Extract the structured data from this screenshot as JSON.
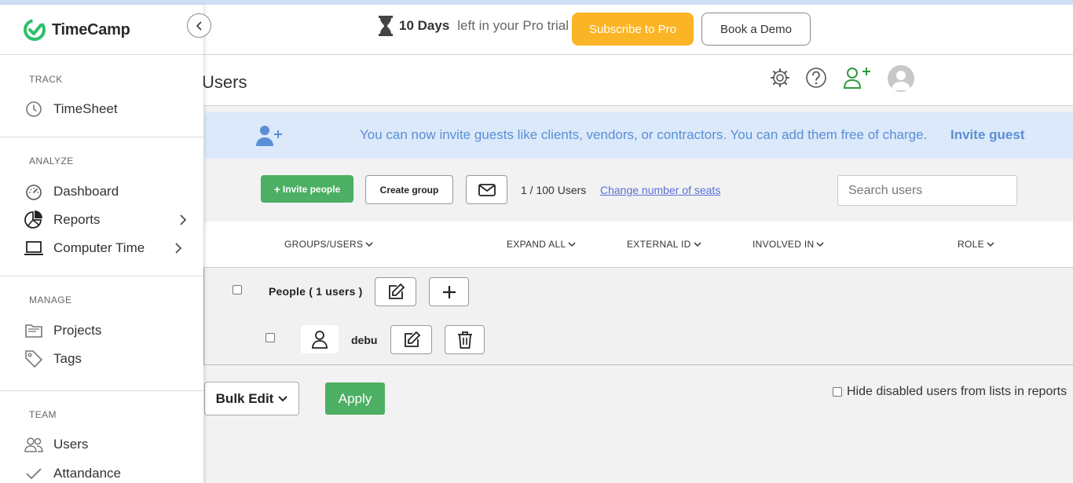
{
  "app": {
    "name": "TimeCamp"
  },
  "sidebar": {
    "sections": [
      {
        "label": "TRACK",
        "items": [
          {
            "label": "TimeSheet"
          }
        ]
      },
      {
        "label": "ANALYZE",
        "items": [
          {
            "label": "Dashboard"
          },
          {
            "label": "Reports"
          },
          {
            "label": "Computer Time"
          }
        ]
      },
      {
        "label": "MANAGE",
        "items": [
          {
            "label": "Projects"
          },
          {
            "label": "Tags"
          }
        ]
      },
      {
        "label": "TEAM",
        "items": [
          {
            "label": "Users"
          },
          {
            "label": "Attandance"
          }
        ]
      }
    ]
  },
  "header": {
    "trial_days": "10 Days",
    "trial_rest": "left in your Pro trial",
    "subscribe_label": "Subscribe to Pro",
    "demo_label": "Book a Demo"
  },
  "page": {
    "title": "Users"
  },
  "banner": {
    "text": "You can now invite guests like clients, vendors, or contractors. You can add them free of charge.",
    "link": "Invite guest"
  },
  "toolbar": {
    "invite_label": "Invite people",
    "create_group_label": "Create group",
    "users_count": "1 / 100 Users",
    "seats_link": "Change number of seats",
    "search_placeholder": "Search users"
  },
  "table": {
    "columns": [
      "GROUPS/USERS",
      "EXPAND ALL",
      "EXTERNAL ID",
      "INVOLVED IN",
      "ROLE"
    ],
    "group": {
      "name": "People ( 1 users )"
    },
    "users": [
      {
        "name": "debu"
      }
    ]
  },
  "footer": {
    "bulk_edit_label": "Bulk Edit",
    "apply_label": "Apply",
    "hide_disabled_label": "Hide disabled users from lists in reports"
  },
  "colors": {
    "brand_green": "#4caf63",
    "subscribe_orange": "#fbb425",
    "banner_bg": "#dbe9fb",
    "banner_text": "#5b8fd4"
  }
}
